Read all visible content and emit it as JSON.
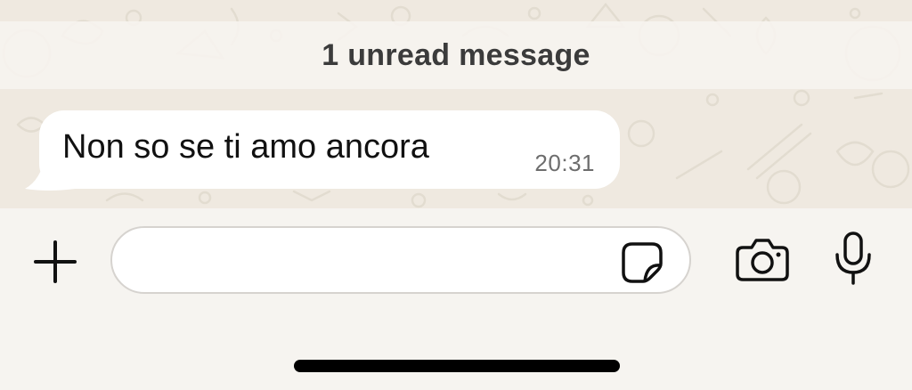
{
  "banner": {
    "unread_text": "1 unread message"
  },
  "message": {
    "text": "Non so se ti amo ancora",
    "time": "20:31",
    "direction": "incoming"
  },
  "composer": {
    "input_value": "",
    "icons": {
      "add": "plus-icon",
      "sticker": "sticker-icon",
      "camera": "camera-icon",
      "mic": "microphone-icon"
    }
  },
  "colors": {
    "chat_background": "#efe9e0",
    "banner_background": "#f7f4ef",
    "bubble": "#ffffff",
    "text": "#111111",
    "timestamp": "#6d6d6d",
    "composer_background": "#f6f4f0"
  }
}
